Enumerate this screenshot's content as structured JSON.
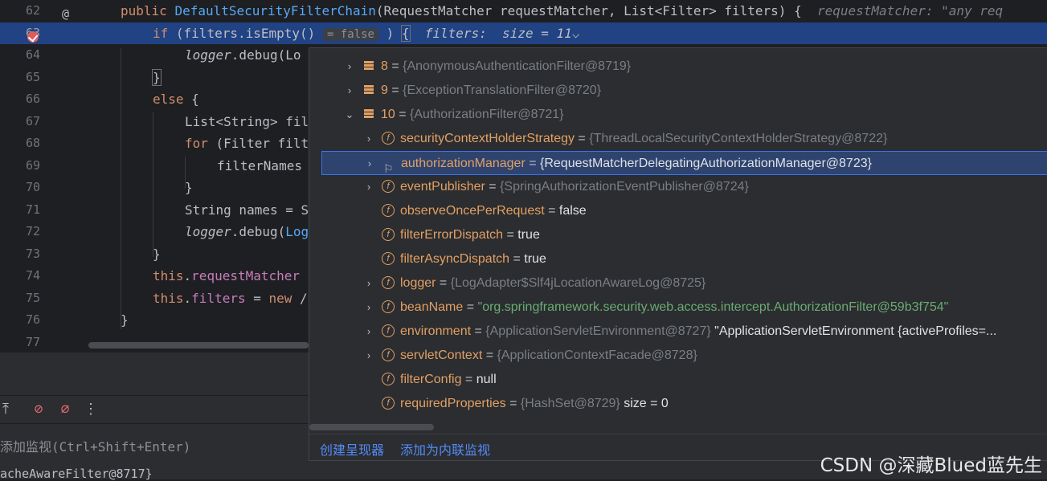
{
  "editor": {
    "lines": [
      {
        "num": "62",
        "parts": [
          [
            "kw",
            "public "
          ],
          [
            "fn",
            "DefaultSecurityFilterChain"
          ],
          [
            "",
            "(RequestMatcher requestMatcher, List<Filter> filters) {  "
          ],
          [
            "cm",
            "requestMatcher: \"any req"
          ]
        ]
      },
      {
        "num": "63",
        "parts": [
          [
            "kw",
            "if "
          ],
          [
            "",
            "(filters.isEmpty() "
          ],
          [
            "inlay",
            "= false"
          ],
          [
            "",
            " ) "
          ],
          [
            "brace",
            "{"
          ],
          [
            "",
            "  "
          ],
          [
            "dbg-hint",
            "filters:  size = 11"
          ],
          [
            "",
            "⌵"
          ]
        ]
      },
      {
        "num": "64",
        "parts": [
          [
            "it",
            "logger"
          ],
          [
            "",
            ".debug(Lo"
          ]
        ]
      },
      {
        "num": "65",
        "parts": [
          [
            "brace",
            "}"
          ]
        ]
      },
      {
        "num": "66",
        "parts": [
          [
            "kw",
            "else "
          ],
          [
            "",
            "{"
          ]
        ]
      },
      {
        "num": "67",
        "parts": [
          [
            "",
            "List<String> fil"
          ]
        ]
      },
      {
        "num": "68",
        "parts": [
          [
            "kw",
            "for "
          ],
          [
            "",
            "(Filter filt"
          ]
        ]
      },
      {
        "num": "69",
        "parts": [
          [
            "",
            "filterNames"
          ]
        ]
      },
      {
        "num": "70",
        "parts": [
          [
            "",
            "}"
          ]
        ]
      },
      {
        "num": "71",
        "parts": [
          [
            "",
            "String names = S"
          ]
        ]
      },
      {
        "num": "72",
        "parts": [
          [
            "it",
            "logger"
          ],
          [
            "",
            ".debug("
          ],
          [
            "fn",
            "Log"
          ]
        ]
      },
      {
        "num": "73",
        "parts": [
          [
            "",
            "}"
          ]
        ]
      },
      {
        "num": "74",
        "parts": [
          [
            "kw",
            "this"
          ],
          [
            "",
            "."
          ],
          [
            "pu",
            "requestMatcher"
          ]
        ]
      },
      {
        "num": "75",
        "parts": [
          [
            "kw",
            "this"
          ],
          [
            "",
            "."
          ],
          [
            "pu",
            "filters"
          ],
          [
            "",
            " = "
          ],
          [
            "kw",
            "new "
          ],
          [
            "",
            "/"
          ]
        ]
      },
      {
        "num": "76",
        "parts": [
          [
            "",
            "}"
          ]
        ]
      },
      {
        "num": "77",
        "parts": [
          [
            "",
            ""
          ]
        ]
      }
    ],
    "gutter_override_icon": "override-at-icon",
    "gutter_override_glyph": "@",
    "breakpoint_icon": "breakpoint-check-icon"
  },
  "debug_panel": {
    "toolbar_icons": [
      {
        "name": "export-icon",
        "glyph": "⤒"
      },
      {
        "name": "breakpoints-icon",
        "glyph": "⊘"
      },
      {
        "name": "mute-breakpoints-icon",
        "glyph": "⌀"
      },
      {
        "name": "more-icon",
        "glyph": "⋮"
      }
    ],
    "watch_placeholder": "添加监视(Ctrl+Shift+Enter)",
    "frame_text": "acheAwareFilter@8717}"
  },
  "popup": {
    "rows": [
      {
        "indent": 0,
        "chevron": "›",
        "icon": "array",
        "name": "8",
        "eq": " = ",
        "ref": "{AnonymousAuthenticationFilter@8719}",
        "value": "",
        "string": ""
      },
      {
        "indent": 0,
        "chevron": "›",
        "icon": "array",
        "name": "9",
        "eq": " = ",
        "ref": "{ExceptionTranslationFilter@8720}",
        "value": "",
        "string": ""
      },
      {
        "indent": 0,
        "chevron": "⌄",
        "icon": "array",
        "name": "10",
        "eq": " = ",
        "ref": "{AuthorizationFilter@8721}",
        "value": "",
        "string": ""
      },
      {
        "indent": 1,
        "chevron": "›",
        "icon": "field",
        "name": "securityContextHolderStrategy",
        "eq": " = ",
        "ref": "{ThreadLocalSecurityContextHolderStrategy@8722}",
        "value": "",
        "string": ""
      },
      {
        "indent": 1,
        "chevron": "›",
        "icon": "flag",
        "name": "authorizationManager",
        "eq": " = ",
        "ref": "",
        "value": "{RequestMatcherDelegatingAuthorizationManager@8723}",
        "string": "",
        "selected": true
      },
      {
        "indent": 1,
        "chevron": "›",
        "icon": "field",
        "name": "eventPublisher",
        "eq": " = ",
        "ref": "{SpringAuthorizationEventPublisher@8724}",
        "value": "",
        "string": ""
      },
      {
        "indent": 1,
        "chevron": "",
        "icon": "field",
        "name": "observeOncePerRequest",
        "eq": " = ",
        "ref": "",
        "value": "false",
        "string": ""
      },
      {
        "indent": 1,
        "chevron": "",
        "icon": "field",
        "name": "filterErrorDispatch",
        "eq": " = ",
        "ref": "",
        "value": "true",
        "string": ""
      },
      {
        "indent": 1,
        "chevron": "",
        "icon": "field",
        "name": "filterAsyncDispatch",
        "eq": " = ",
        "ref": "",
        "value": "true",
        "string": ""
      },
      {
        "indent": 1,
        "chevron": "›",
        "icon": "field",
        "name": "logger",
        "eq": " = ",
        "ref": "{LogAdapter$Slf4jLocationAwareLog@8725}",
        "value": "",
        "string": ""
      },
      {
        "indent": 1,
        "chevron": "›",
        "icon": "field",
        "name": "beanName",
        "eq": " = ",
        "ref": "",
        "value": "",
        "string": "\"org.springframework.security.web.access.intercept.AuthorizationFilter@59b3f754\""
      },
      {
        "indent": 1,
        "chevron": "›",
        "icon": "field",
        "name": "environment",
        "eq": " = ",
        "ref": "{ApplicationServletEnvironment@8727}",
        "value": " \"ApplicationServletEnvironment {activeProfiles=...",
        "string": ""
      },
      {
        "indent": 1,
        "chevron": "›",
        "icon": "field",
        "name": "servletContext",
        "eq": " = ",
        "ref": "{ApplicationContextFacade@8728}",
        "value": "",
        "string": ""
      },
      {
        "indent": 1,
        "chevron": "",
        "icon": "field",
        "name": "filterConfig",
        "eq": " = ",
        "ref": "",
        "value": "null",
        "string": ""
      },
      {
        "indent": 1,
        "chevron": "",
        "icon": "field",
        "name": "requiredProperties",
        "eq": " = ",
        "ref": "{HashSet@8729}",
        "value": "  size = 0",
        "string": ""
      }
    ],
    "footer": {
      "create_renderer": "创建呈现器",
      "add_inline_watch": "添加为内联监视"
    }
  },
  "watermark": "CSDN @深藏Blued蓝先生",
  "colors": {
    "accent": "#3574f0",
    "field": "#e3a064",
    "string": "#6aab73",
    "selection": "#214283"
  }
}
